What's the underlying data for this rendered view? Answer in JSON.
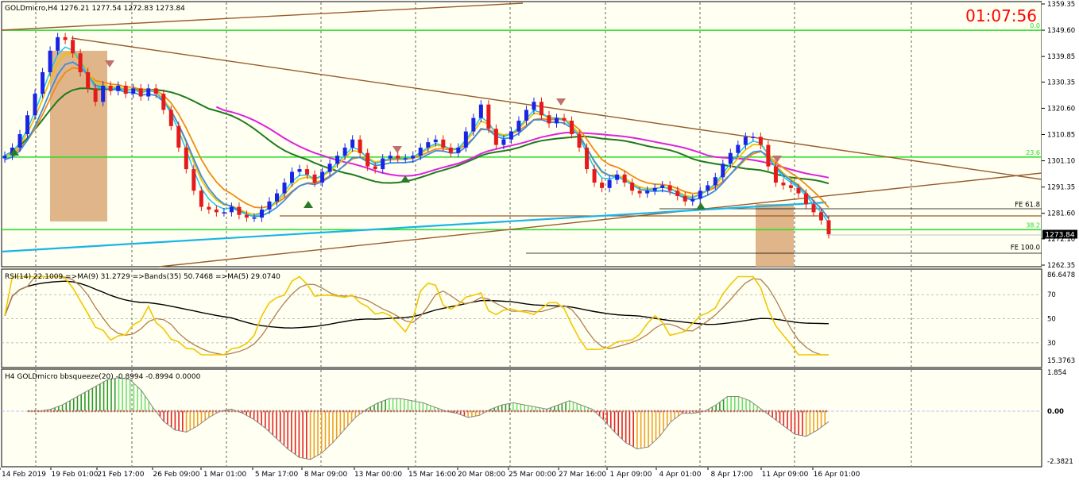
{
  "colors": {
    "background": "#ffffff",
    "chart_bg": "#fffff2",
    "bull_candle": "#1a24e6",
    "bear_candle": "#e61a1a",
    "grid": "#000000",
    "green_line": "#22dd22",
    "trend_brown": "#9a5a2a",
    "ma_cyan": "#19c8f0",
    "ma_blue": "#3c8ce0",
    "ma_yellow": "#f0c000",
    "ma_orange": "#f08a14",
    "ma_green": "#1e7a1e",
    "ma_magenta": "#dd22dd",
    "fib_zone": "#d9a877",
    "clock": "#ff0000"
  },
  "main_panel": {
    "title": "GOLDmicro,H4  1276.21 1277.54 1272.83 1273.84",
    "clock": "01:07:56",
    "price_axis": [
      "1359.35",
      "1349.60",
      "1339.85",
      "1330.35",
      "1320.60",
      "1310.85",
      "1301.10",
      "1291.35",
      "1281.60",
      "1272.10",
      "1262.35"
    ],
    "price_axis_values": [
      1359.35,
      1349.6,
      1339.85,
      1330.35,
      1320.6,
      1310.85,
      1301.1,
      1291.35,
      1281.6,
      1272.1,
      1262.35
    ],
    "current_price": "1273.84",
    "current_price_value": 1273.84,
    "fib_labels": [
      {
        "text": "0.0",
        "price": 1349.6
      },
      {
        "text": "23.6",
        "price": 1302.5
      },
      {
        "text": "38.2",
        "price": 1275.5
      }
    ],
    "fe_labels": [
      {
        "text": "FE 61.8",
        "price": 1283.5
      },
      {
        "text": "FE 100.0",
        "price": 1267.5
      }
    ]
  },
  "rsi_panel": {
    "title": "RSI(14) 22.1009  =>MA(9) 31.2729  =>Bands(35) 50.7468  =>MA(5) 29.0740",
    "axis": [
      "86.6478",
      "70",
      "50",
      "30",
      "15.3763"
    ],
    "axis_values": [
      86.6478,
      70,
      50,
      30,
      15.3763
    ]
  },
  "squeeze_panel": {
    "title": "H4 GOLDmicro bbsqueeze(20) -0.8994 -0.8994 0.0000",
    "axis": [
      "1.854",
      "0.00",
      "-2.3821"
    ],
    "axis_values": [
      1.854,
      0.0,
      -2.3821
    ]
  },
  "time_axis": [
    "14 Feb 2019",
    "19 Feb 01:00",
    "21 Feb 17:00",
    "26 Feb 09:00",
    "1 Mar 01:00",
    "5 Mar 17:00",
    "8 Mar 09:00",
    "13 Mar 00:00",
    "15 Mar 16:00",
    "20 Mar 08:00",
    "25 Mar 00:00",
    "27 Mar 16:00",
    "1 Apr 09:00",
    "4 Apr 01:00",
    "8 Apr 17:00",
    "11 Apr 09:00",
    "16 Apr 01:00"
  ],
  "series": {
    "close": [
      1303,
      1306,
      1311,
      1318,
      1326,
      1334,
      1342,
      1347,
      1346,
      1341,
      1334,
      1328,
      1323,
      1329,
      1327,
      1329,
      1326,
      1328,
      1325,
      1328,
      1326,
      1320,
      1314,
      1306,
      1298,
      1290,
      1284,
      1283,
      1282,
      1282,
      1284,
      1281,
      1280,
      1280,
      1283,
      1286,
      1289,
      1293,
      1297,
      1298,
      1296,
      1293,
      1297,
      1300,
      1303,
      1306,
      1309,
      1304,
      1299,
      1298,
      1302,
      1303,
      1302,
      1302,
      1303,
      1306,
      1308,
      1309,
      1306,
      1304,
      1306,
      1312,
      1317,
      1322,
      1313,
      1307,
      1309,
      1312,
      1316,
      1320,
      1323,
      1318,
      1315,
      1317,
      1316,
      1311,
      1306,
      1298,
      1293,
      1291,
      1294,
      1296,
      1293,
      1290,
      1289,
      1290,
      1291,
      1292,
      1290,
      1288,
      1286,
      1287,
      1290,
      1292,
      1295,
      1300,
      1304,
      1307,
      1310,
      1310,
      1307,
      1299,
      1293,
      1292,
      1291,
      1289,
      1285,
      1282,
      1279,
      1273.84
    ],
    "bbsqueeze": [
      0,
      0,
      0.1,
      0.3,
      0.6,
      0.9,
      1.2,
      1.5,
      1.6,
      1.5,
      1.0,
      0.2,
      -0.5,
      -0.9,
      -1.0,
      -0.7,
      -0.3,
      0.0,
      0.1,
      -0.1,
      -0.4,
      -0.8,
      -1.3,
      -1.8,
      -2.2,
      -2.3,
      -2.0,
      -1.5,
      -0.9,
      -0.3,
      0.1,
      0.4,
      0.6,
      0.6,
      0.5,
      0.4,
      0.2,
      0.0,
      -0.1,
      -0.3,
      -0.2,
      0.1,
      0.3,
      0.4,
      0.3,
      0.2,
      0.1,
      0.3,
      0.5,
      0.3,
      0.1,
      -0.4,
      -1.0,
      -1.5,
      -1.8,
      -1.7,
      -1.2,
      -0.5,
      -0.1,
      -0.1,
      0.0,
      0.3,
      0.7,
      0.7,
      0.5,
      0.1,
      -0.3,
      -0.7,
      -1.1,
      -1.2,
      -0.9,
      -0.5
    ]
  }
}
